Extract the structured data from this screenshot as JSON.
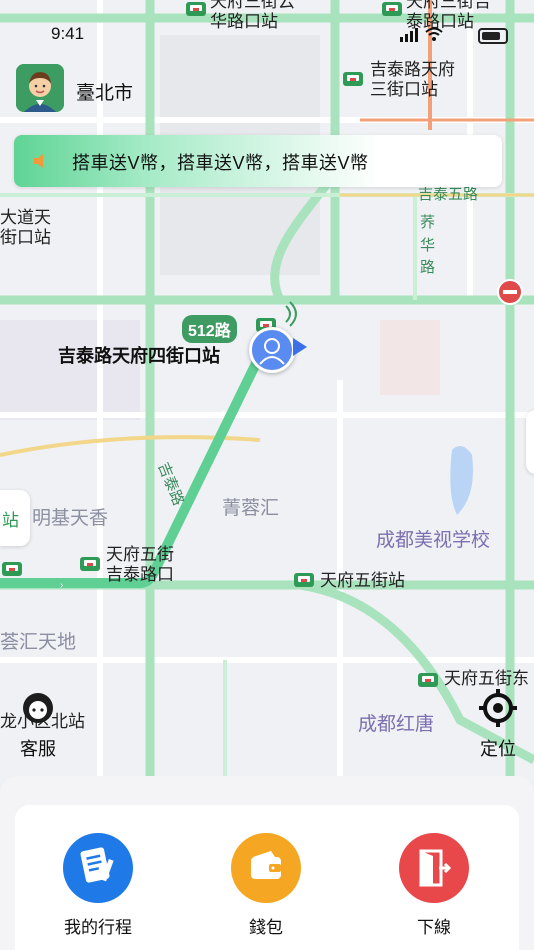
{
  "status": {
    "time": "9:41"
  },
  "header": {
    "city": "臺北市"
  },
  "notice": {
    "text": "搭車送V幣，搭車送V幣，搭車送V幣"
  },
  "map": {
    "route_badge": "512路",
    "current_stop": "吉泰路天府四街口站",
    "labels": {
      "top_stop_1": "天府三街云华路口站",
      "top_stop_1a": "天府三街云",
      "top_stop_1b": "华路口站",
      "top_stop_2a": "天府三街吉",
      "top_stop_2b": "泰路口站",
      "stop_jitai_a": "吉泰路天府",
      "stop_jitai_b": "三街口站",
      "road_jitai5": "吉泰五路",
      "road_jiaonan_a": "荞",
      "road_jiaonan_b": "华",
      "road_jiaonan_c": "路",
      "dadao_a": "大道天",
      "dadao_b": "街口站",
      "road_jitai_rd": "吉泰路",
      "qingronghui": "菁蓉汇",
      "mingji": "明基天香",
      "school": "成都美视学校",
      "stop_tf5_a": "天府五街",
      "stop_tf5_b": "吉泰路口",
      "stop_tf5": "天府五街站",
      "huitiandi": "荟汇天地",
      "stop_tf5_east": "天府五街东",
      "stop_longxiao": "龙小区北站",
      "honglang": "成都红唐",
      "road_a": "路"
    },
    "side_tab": "站"
  },
  "controls": {
    "service_label": "客服",
    "locate_label": "定位"
  },
  "actions": [
    {
      "label": "我的行程",
      "icon": "document-icon",
      "color": "#1f7ae8"
    },
    {
      "label": "錢包",
      "icon": "wallet-icon",
      "color": "#f5a623"
    },
    {
      "label": "下線",
      "icon": "logout-door-icon",
      "color": "#e8484a"
    }
  ]
}
